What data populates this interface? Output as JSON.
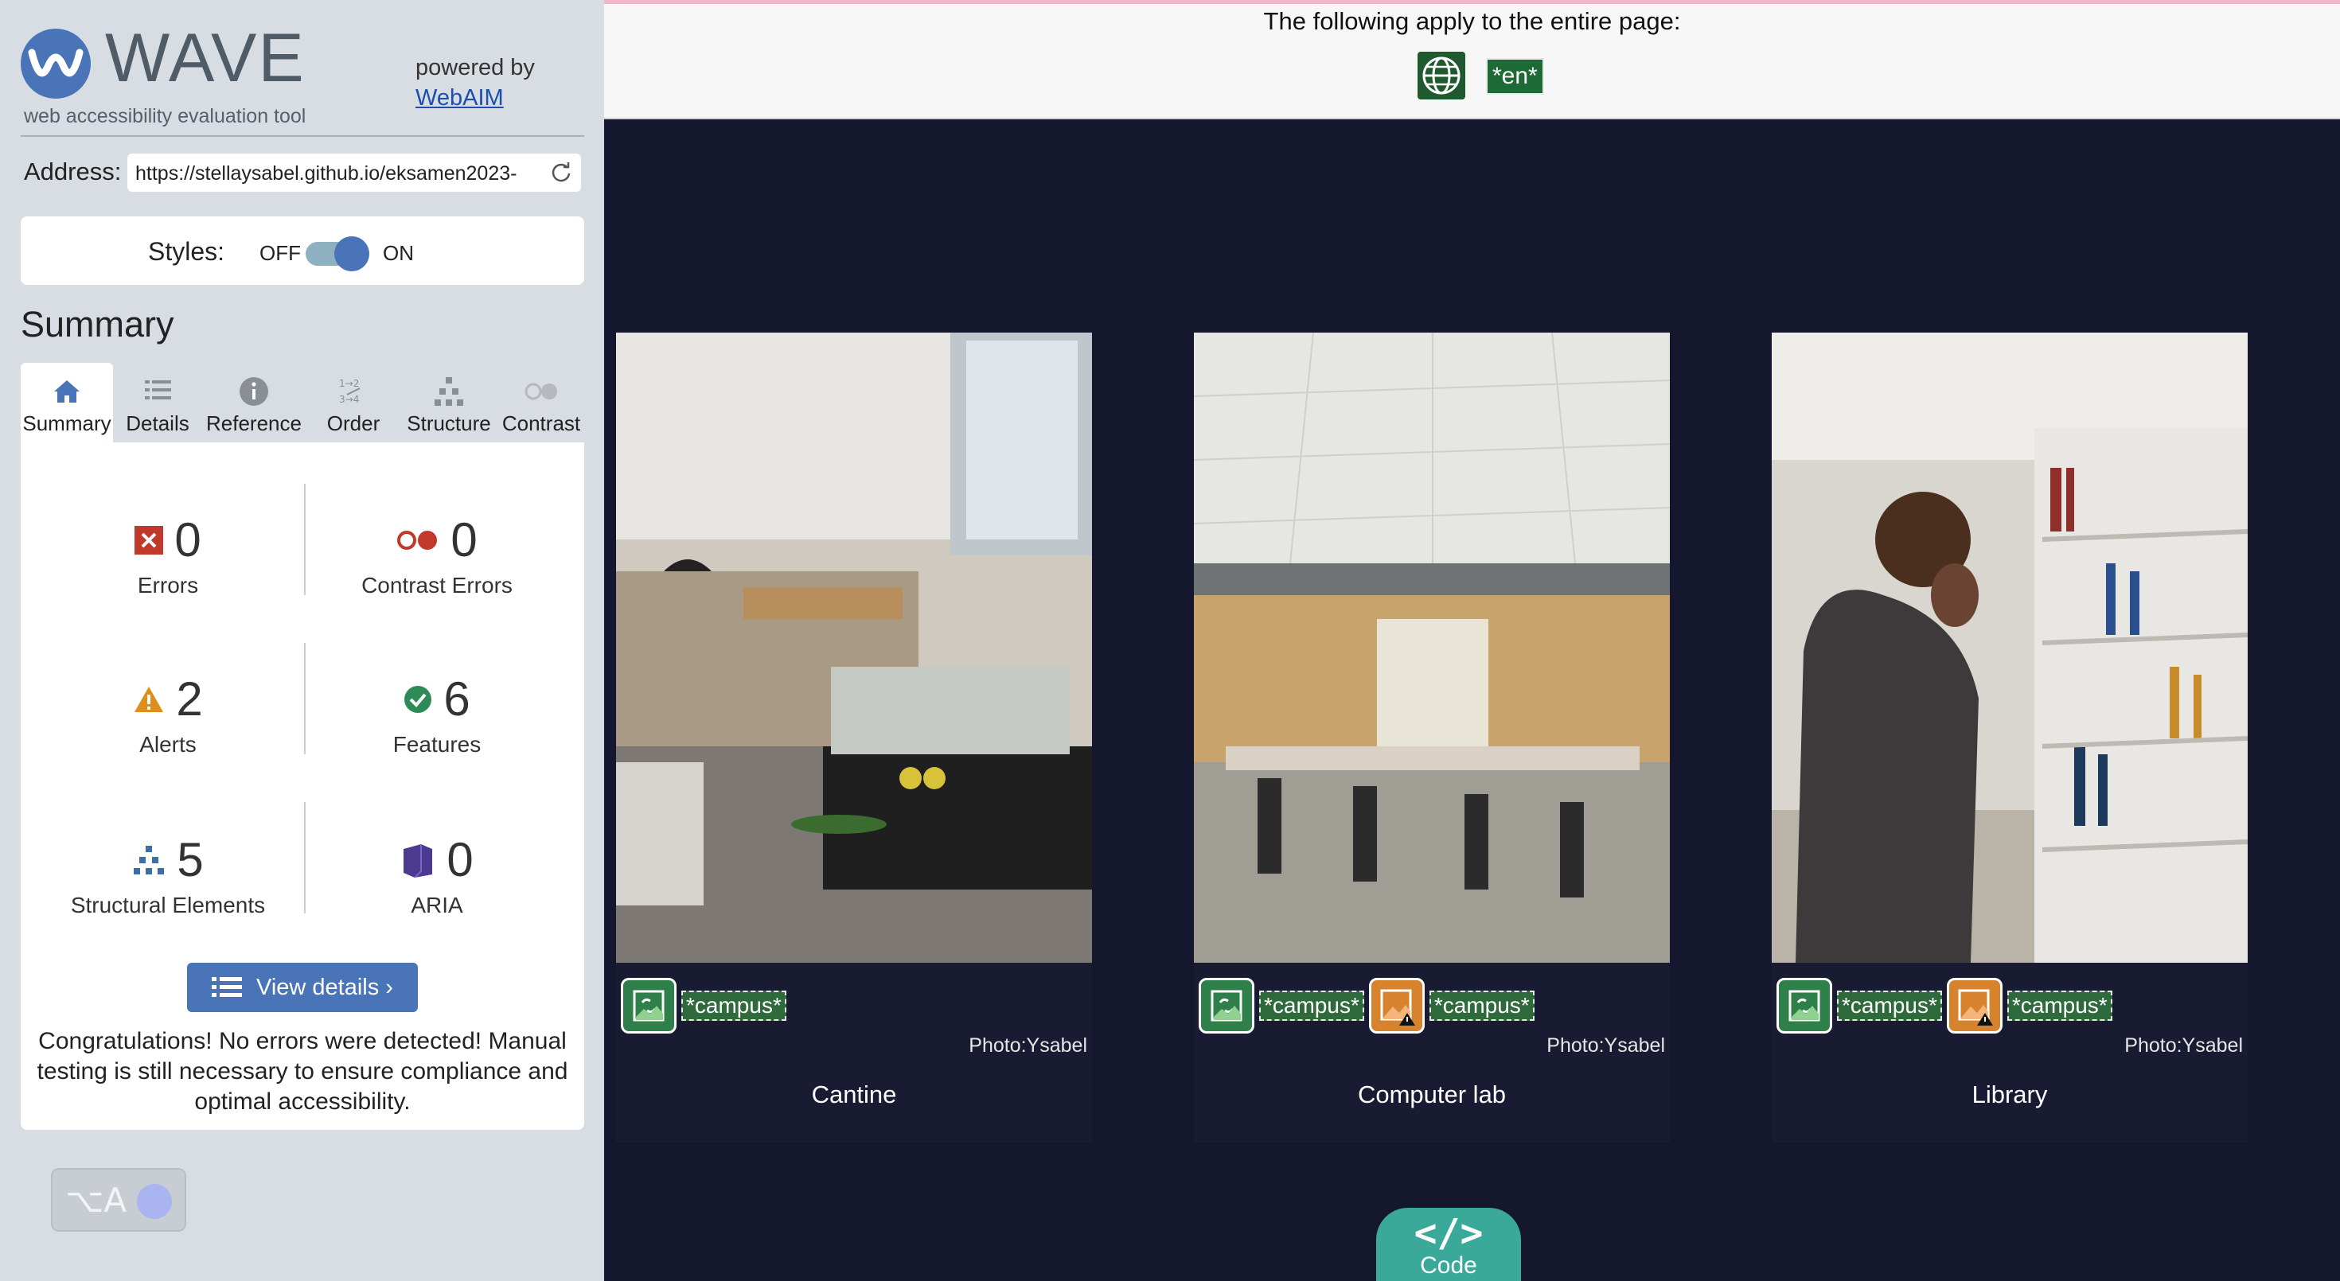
{
  "brand": {
    "name": "WAVE",
    "tagline": "web accessibility evaluation tool",
    "powered_by": "powered by",
    "powered_link": "WebAIM"
  },
  "address": {
    "label": "Address:",
    "value": "https://stellaysabel.github.io/eksamen2023-"
  },
  "styles": {
    "label": "Styles:",
    "off": "OFF",
    "on": "ON",
    "state": "on"
  },
  "summary_title": "Summary",
  "tabs": [
    {
      "label": "Summary",
      "icon": "home-icon",
      "active": true
    },
    {
      "label": "Details",
      "icon": "list-icon"
    },
    {
      "label": "Reference",
      "icon": "info-icon"
    },
    {
      "label": "Order",
      "icon": "order-icon"
    },
    {
      "label": "Structure",
      "icon": "structure-icon"
    },
    {
      "label": "Contrast",
      "icon": "contrast-icon"
    }
  ],
  "stats": {
    "errors": {
      "count": "0",
      "label": "Errors",
      "color": "#c0392b"
    },
    "contrast_errors": {
      "count": "0",
      "label": "Contrast Errors",
      "color": "#c0392b"
    },
    "alerts": {
      "count": "2",
      "label": "Alerts",
      "color": "#e08e1b"
    },
    "features": {
      "count": "6",
      "label": "Features",
      "color": "#2e8b57"
    },
    "structural": {
      "count": "5",
      "label": "Structural Elements",
      "color": "#3a6ea5"
    },
    "aria": {
      "count": "0",
      "label": "ARIA",
      "color": "#4b3a8f"
    }
  },
  "view_details": "View details ›",
  "congrats": "Congratulations! No errors were detected! Manual testing is still necessary to ensure compliance and optimal accessibility.",
  "a11y_button": "⌥A",
  "page_panel": {
    "text": "The following apply to the entire page:",
    "lang_tag": "*en*"
  },
  "cards": [
    {
      "caption": "Cantine",
      "credit": "Photo:Ysabel",
      "tags": [
        {
          "type": "link",
          "text": "*campus*"
        }
      ]
    },
    {
      "caption": "Computer lab",
      "credit": "Photo:Ysabel",
      "tags": [
        {
          "type": "link",
          "text": "*campus*"
        },
        {
          "type": "image-alert",
          "text": "*campus*"
        }
      ]
    },
    {
      "caption": "Library",
      "credit": "Photo:Ysabel",
      "tags": [
        {
          "type": "link",
          "text": "*campus*"
        },
        {
          "type": "image-alert",
          "text": "*campus*"
        }
      ]
    }
  ],
  "code_button": {
    "symbol": "</>",
    "label": "Code"
  }
}
